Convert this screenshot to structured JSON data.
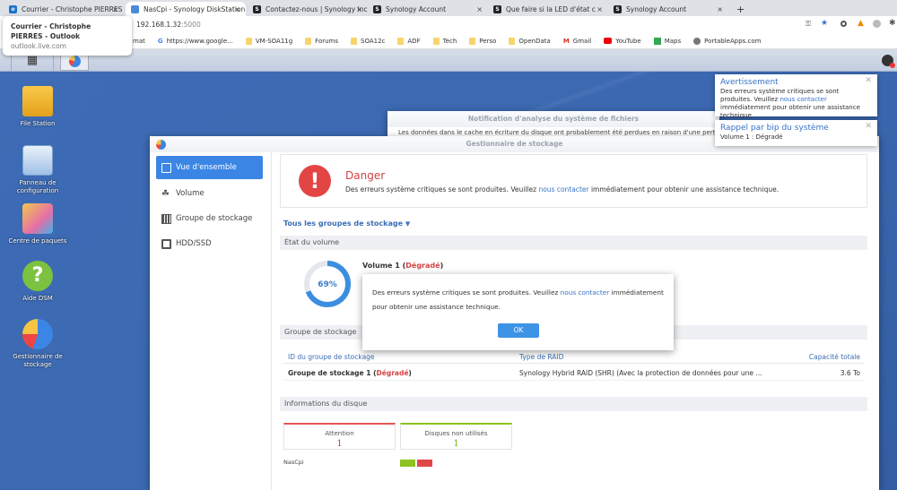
{
  "browser": {
    "tabs": [
      {
        "title": "Courrier - Christophe PIERRES - O",
        "icon": "outlook-icon"
      },
      {
        "title": "NasCpi - Synology DiskStation",
        "icon": "dsm-icon"
      },
      {
        "title": "Contactez-nous | Synology Inc.",
        "icon": "synology-icon"
      },
      {
        "title": "Synology Account",
        "icon": "synology-icon"
      },
      {
        "title": "Que faire si la LED d'état clignote",
        "icon": "synology-icon"
      },
      {
        "title": "Synology Account",
        "icon": "synology-icon"
      }
    ],
    "new_tab": "+",
    "close": "×",
    "url_host": "192.168.1.32",
    "url_port": ":5000",
    "bookmarks": [
      "mat",
      "https://www.google...",
      "VM-SOA11g",
      "Forums",
      "SOA12c",
      "ADF",
      "Tech",
      "Perso",
      "OpenData",
      "Gmail",
      "YouTube",
      "Maps",
      "PortableApps.com"
    ],
    "tooltip": {
      "title": "Courrier - Christophe PIERRES - Outlook",
      "url": "outlook.live.com"
    }
  },
  "desktop": {
    "icons": [
      "File Station",
      "Panneau de configuration",
      "Centre de paquets",
      "Aide DSM",
      "Gestionnaire de stockage"
    ]
  },
  "bg_window": {
    "title": "Notification d'analyse du système de fichiers",
    "text": "Les données dans le cache en écriture du disque ont probablement été perdues en raison d'une perte..."
  },
  "notifications": [
    {
      "title": "Avertissement",
      "pre": "Des erreurs système critiques se sont produites. Veuillez ",
      "link": "nous contacter",
      "post": " immédiatement pour obtenir une assistance technique."
    },
    {
      "title": "Rappel par bip du système",
      "text": "Volume 1 : Dégradé"
    }
  ],
  "storage": {
    "title": "Gestionnaire de stockage",
    "sidebar": [
      "Vue d'ensemble",
      "Volume",
      "Groupe de stockage",
      "HDD/SSD"
    ],
    "danger": {
      "title": "Danger",
      "pre": "Des erreurs système critiques se sont produites. Veuillez ",
      "link": "nous contacter",
      "post": " immédiatement pour obtenir une assistance technique."
    },
    "filter": "Tous les groupes de stockage",
    "volume_header": "État du volume",
    "volume": {
      "name": "Volume 1",
      "status": "Dégradé",
      "usage_percent": 69,
      "usage_label": "69%"
    },
    "pool_header": "Groupe de stockage",
    "pool_table": {
      "columns": [
        "ID du groupe de stockage",
        "Type de RAID",
        "Capacité totale"
      ],
      "rows": [
        {
          "name": "Groupe de stockage 1",
          "status": "Dégradé",
          "raid": "Synology Hybrid RAID (SHR) (Avec la protection de données pour une ...",
          "capacity": "3.6 To"
        }
      ]
    },
    "disk_header": "Informations du disque",
    "cards": [
      {
        "label": "Attention",
        "value": "1"
      },
      {
        "label": "Disques non utilisés",
        "value": "1"
      }
    ],
    "nas_name": "NasCpi",
    "disk_states": [
      "#8dc21f",
      "#e04848"
    ]
  },
  "modal": {
    "pre": "Des erreurs système critiques se sont produites. Veuillez ",
    "link": "nous contacter",
    "post": " immédiatement pour obtenir une assistance technique.",
    "ok": "OK"
  }
}
